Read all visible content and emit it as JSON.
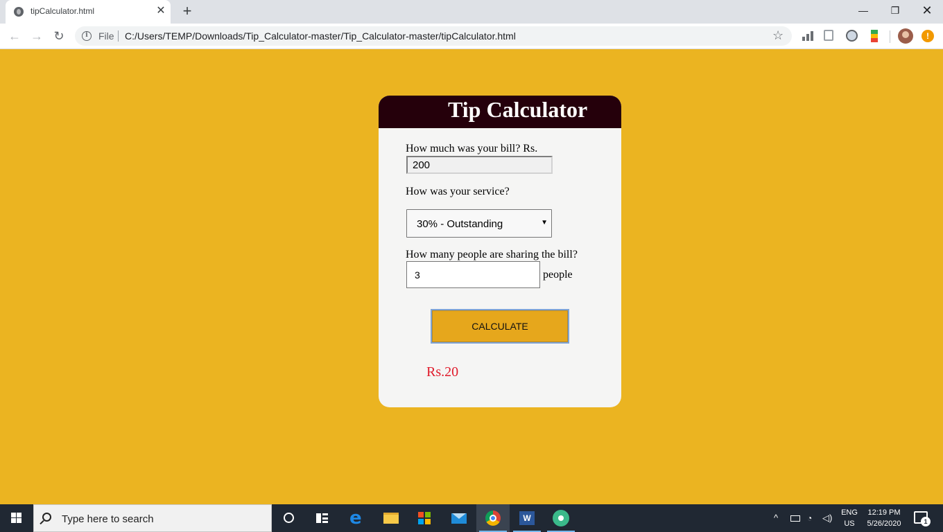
{
  "browser": {
    "tab_title": "tipCalculator.html",
    "tab_close": "✕",
    "new_tab": "+",
    "window_controls": {
      "minimize": "—",
      "restore": "❐",
      "close": "✕"
    },
    "url_scheme": "File",
    "url": "C:/Users/TEMP/Downloads/Tip_Calculator-master/Tip_Calculator-master/tipCalculator.html",
    "nav_icons": {
      "back": "←",
      "forward": "→",
      "reload": "↻",
      "bookmark": "☆"
    }
  },
  "app": {
    "title": "Tip Calculator",
    "bill_label": "How much was your bill? Rs.",
    "bill_value": "200",
    "service_label": "How was your service?",
    "service_selected": "30% - Outstanding",
    "people_label": "How many people are sharing the bill?",
    "people_value": "3",
    "people_suffix": "people",
    "calculate_label": "CALCULATE",
    "result": "Rs.20",
    "colors": {
      "background": "#ebb421",
      "header": "#25000b",
      "button": "#e6a71c",
      "result": "#e01a2a"
    }
  },
  "taskbar": {
    "search_placeholder": "Type here to search",
    "tray_arrow": "^",
    "lang_line1": "ENG",
    "lang_line2": "US",
    "time": "12:19 PM",
    "date": "5/26/2020",
    "notification_count": "1"
  }
}
